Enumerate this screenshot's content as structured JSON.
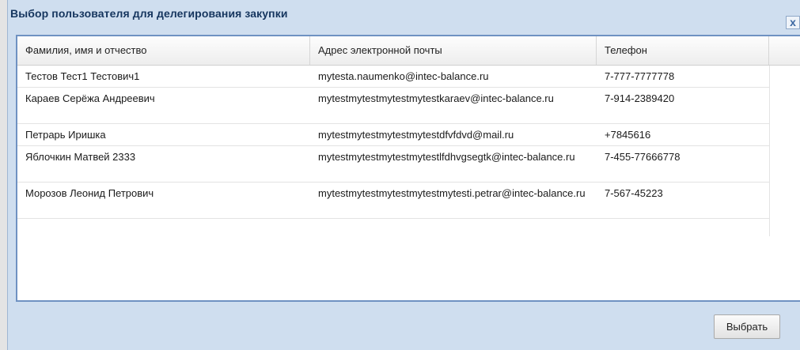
{
  "dialog": {
    "title": "Выбор пользователя для делегирования закупки",
    "close_label": "x"
  },
  "table": {
    "headers": {
      "name": "Фамилия, имя и отчество",
      "email": "Адрес электронной почты",
      "phone": "Телефон"
    },
    "rows": [
      {
        "name": "Тестов Тест1 Тестович1",
        "email": "mytesta.naumenko@intec-balance.ru",
        "phone": "7-777-7777778"
      },
      {
        "name": "Караев Серёжа Андреевич",
        "email": "mytestmytestmytestmytestkaraev@intec-balance.ru",
        "phone": "7-914-2389420"
      },
      {
        "name": "Петрарь Иришка",
        "email": "mytestmytestmytestmytestdfvfdvd@mail.ru",
        "phone": "+7845616"
      },
      {
        "name": "Яблочкин Матвей 2333",
        "email": "mytestmytestmytestmytestlfdhvgsegtk@intec-balance.ru",
        "phone": "7-455-77666778"
      },
      {
        "name": "Морозов Леонид Петрович",
        "email": "mytestmytestmytestmytestmytesti.petrar@intec-balance.ru",
        "phone": "7-567-45223"
      }
    ]
  },
  "footer": {
    "select_label": "Выбрать"
  },
  "colors": {
    "dialog_bg": "#cfdeef",
    "title_text": "#15355e",
    "grid_border": "#6f92c2"
  }
}
